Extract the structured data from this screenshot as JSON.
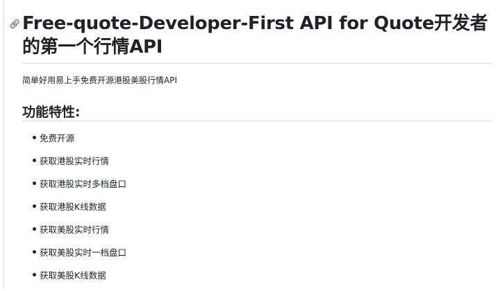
{
  "title": "Free-quote-Developer-First API for Quote开发者的第一个行情API",
  "description": "简单好用易上手免费开源港股美股行情API",
  "features_heading": "功能特性:",
  "features": [
    "免费开源",
    "获取港股实时行情",
    "获取港股实时多档盘口",
    "获取港股K线数据",
    "获取美股实时行情",
    "获取美股实时一档盘口",
    "获取美股K线数据"
  ]
}
